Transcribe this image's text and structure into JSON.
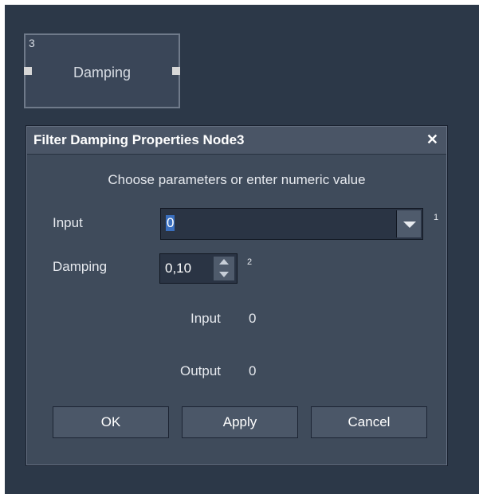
{
  "node": {
    "number": "3",
    "title": "Damping"
  },
  "dialog": {
    "title": "Filter Damping Properties Node3",
    "close_glyph": "✕",
    "subtitle": "Choose parameters or enter numeric value",
    "input": {
      "label": "Input",
      "value": "0",
      "superscript": "1"
    },
    "damping": {
      "label": "Damping",
      "value": "0,10",
      "superscript": "2"
    },
    "readouts": [
      {
        "label": "Input",
        "value": "0"
      },
      {
        "label": "Output",
        "value": "0"
      }
    ],
    "buttons": {
      "ok": "OK",
      "apply": "Apply",
      "cancel": "Cancel"
    }
  },
  "colors": {
    "canvas": "#2c3848",
    "dialog": "#3f4b5b",
    "titlebar": "#4a5566",
    "selection": "#3a6fbf"
  },
  "icons": [
    "close-icon",
    "chevron-down-icon",
    "spin-up-icon",
    "spin-down-icon"
  ]
}
